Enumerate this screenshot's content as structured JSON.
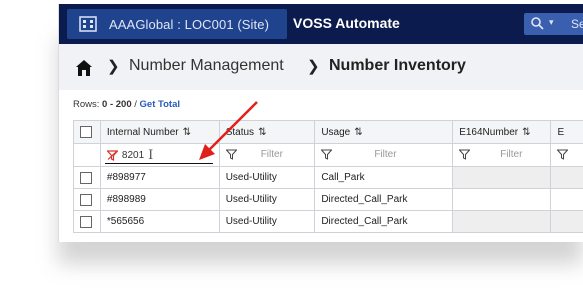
{
  "topbar": {
    "site_label": "AAAGlobal : LOC001 (Site)",
    "app_title": "VOSS Automate",
    "search_text": "Se",
    "icons": [
      "building-icon",
      "search-icon",
      "chevron-down-icon"
    ]
  },
  "breadcrumb": {
    "items": [
      "Number Management",
      "Number Inventory"
    ]
  },
  "grid": {
    "rows_label": "Rows:",
    "rows_range": "0 - 200",
    "rows_sep": "/",
    "get_total": "Get Total",
    "columns": [
      {
        "label": "Internal Number",
        "filter_value": "8201"
      },
      {
        "label": "Status",
        "filter_placeholder": "Filter"
      },
      {
        "label": "Usage",
        "filter_placeholder": "Filter"
      },
      {
        "label": "E164Number",
        "filter_placeholder": "Filter"
      },
      {
        "label": "E"
      }
    ],
    "rows": [
      {
        "internal_number": "#898977",
        "status": "Used-Utility",
        "usage": "Call_Park"
      },
      {
        "internal_number": "#898989",
        "status": "Used-Utility",
        "usage": "Directed_Call_Park"
      },
      {
        "internal_number": "*565656",
        "status": "Used-Utility",
        "usage": "Directed_Call_Park"
      }
    ]
  },
  "colors": {
    "topbar": "#0c1b4d",
    "site_chip": "#20438e",
    "accent_link": "#2a5bb8",
    "annotation_arrow": "#e0201b"
  }
}
